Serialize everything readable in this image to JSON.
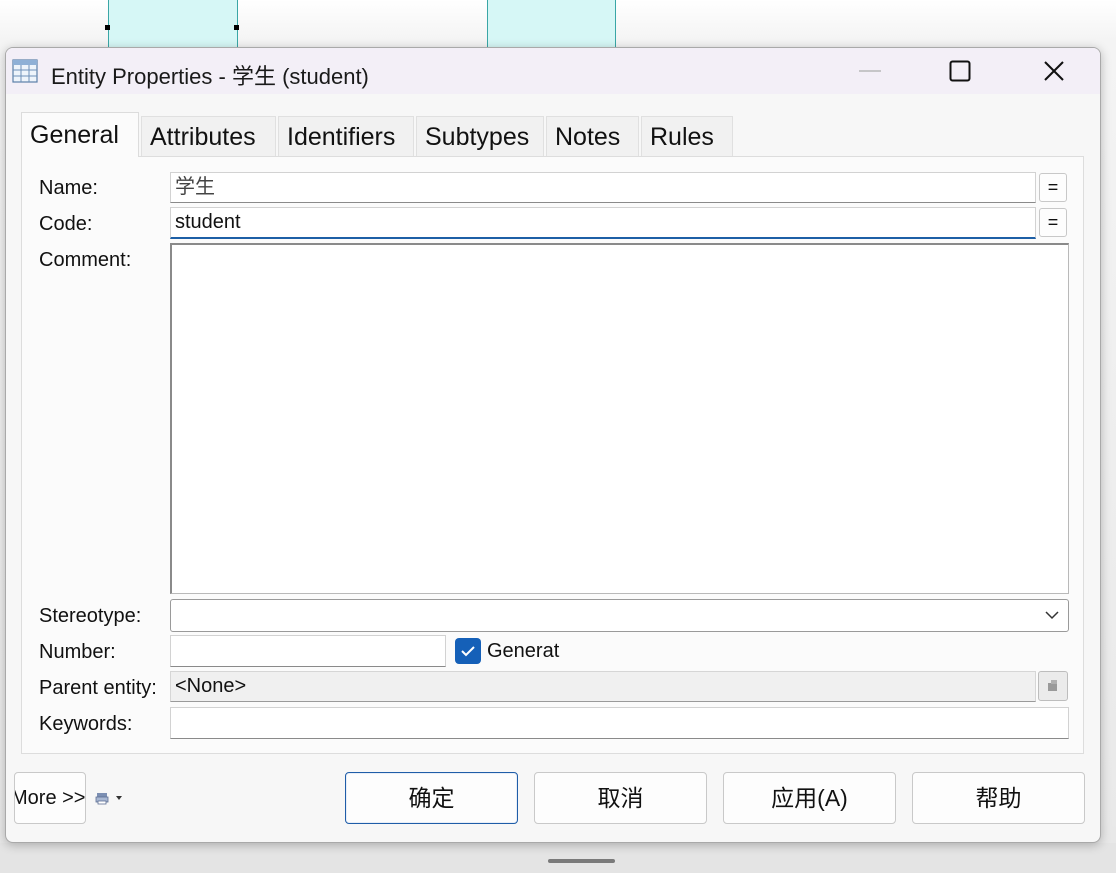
{
  "window": {
    "title": "Entity Properties - 学生 (student)",
    "icon": "table-grid-icon",
    "controls": [
      "minimize-icon",
      "maximize-icon",
      "close-icon"
    ]
  },
  "tabs": [
    {
      "label": "General",
      "active": true
    },
    {
      "label": "Attributes",
      "active": false
    },
    {
      "label": "Identifiers",
      "active": false
    },
    {
      "label": "Subtypes",
      "active": false
    },
    {
      "label": "Notes",
      "active": false
    },
    {
      "label": "Rules",
      "active": false
    }
  ],
  "form": {
    "name_label": "Name:",
    "name_value": "学生",
    "code_label": "Code:",
    "code_value": "student",
    "eq_label": "=",
    "comment_label": "Comment:",
    "comment_value": "",
    "stereotype_label": "Stereotype:",
    "stereotype_value": "",
    "number_label": "Number:",
    "number_value": "",
    "generate_label": "Generat",
    "generate_checked": true,
    "parent_entity_label": "Parent entity:",
    "parent_entity_value": "<None>",
    "keywords_label": "Keywords:",
    "keywords_value": ""
  },
  "footer": {
    "more_label": "More >>",
    "ok_label": "确定",
    "cancel_label": "取消",
    "apply_label": "应用(A)",
    "help_label": "帮助"
  },
  "colors": {
    "accent": "#1560b8",
    "titlebar": "#f3eff7",
    "canvas_shape_fill": "#d6f7f6",
    "canvas_shape_border": "#3aa6a6"
  }
}
